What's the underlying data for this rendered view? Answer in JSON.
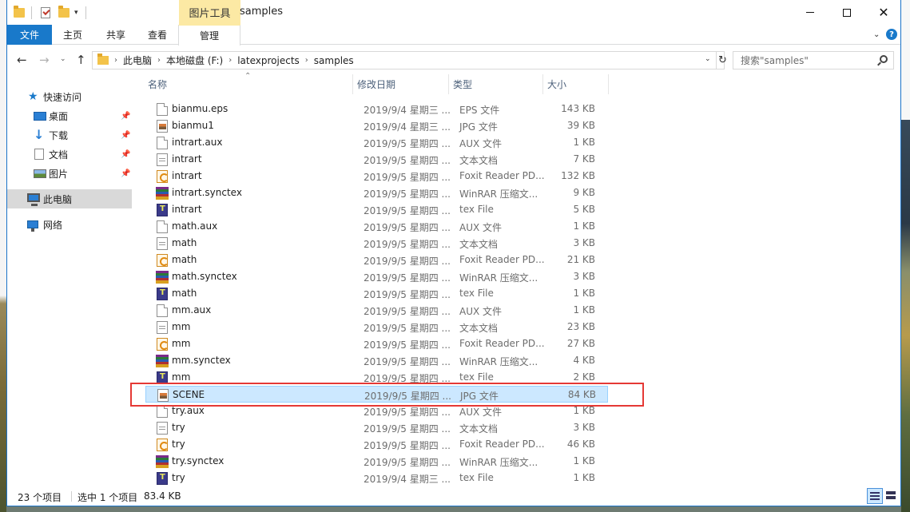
{
  "window": {
    "title": "samples",
    "context_tab_group": "图片工具",
    "quick_access": [
      "folder-icon",
      "properties-check-icon",
      "new-folder-icon",
      "customize-dropdown-icon"
    ]
  },
  "ribbon": {
    "tabs": [
      {
        "label": "文件",
        "active": true
      },
      {
        "label": "主页"
      },
      {
        "label": "共享"
      },
      {
        "label": "查看"
      },
      {
        "label": "管理"
      }
    ]
  },
  "address": {
    "breadcrumbs": [
      "此电脑",
      "本地磁盘 (F:)",
      "latexprojects",
      "samples"
    ]
  },
  "search": {
    "placeholder": "搜索\"samples\""
  },
  "navpane": {
    "quick_access": "快速访问",
    "items": [
      {
        "label": "桌面",
        "icon": "desktop-icon",
        "pinned": true
      },
      {
        "label": "下载",
        "icon": "download-icon",
        "pinned": true
      },
      {
        "label": "文档",
        "icon": "documents-icon",
        "pinned": true
      },
      {
        "label": "图片",
        "icon": "pictures-icon",
        "pinned": true
      }
    ],
    "this_pc": "此电脑",
    "network": "网络"
  },
  "columns": {
    "name": "名称",
    "date": "修改日期",
    "type": "类型",
    "size": "大小"
  },
  "files": [
    {
      "name": "bianmu.eps",
      "date": "2019/9/4 星期三 ...",
      "type": "EPS 文件",
      "size": "143 KB",
      "icon": "blank"
    },
    {
      "name": "bianmu1",
      "date": "2019/9/4 星期三 ...",
      "type": "JPG 文件",
      "size": "39 KB",
      "icon": "jpg"
    },
    {
      "name": "intrart.aux",
      "date": "2019/9/5 星期四 ...",
      "type": "AUX 文件",
      "size": "1 KB",
      "icon": "blank"
    },
    {
      "name": "intrart",
      "date": "2019/9/5 星期四 ...",
      "type": "文本文档",
      "size": "7 KB",
      "icon": "txt"
    },
    {
      "name": "intrart",
      "date": "2019/9/5 星期四 ...",
      "type": "Foxit Reader PD...",
      "size": "132 KB",
      "icon": "pdf"
    },
    {
      "name": "intrart.synctex",
      "date": "2019/9/5 星期四 ...",
      "type": "WinRAR 压缩文...",
      "size": "9 KB",
      "icon": "rar"
    },
    {
      "name": "intrart",
      "date": "2019/9/5 星期四 ...",
      "type": "tex File",
      "size": "5 KB",
      "icon": "tex"
    },
    {
      "name": "math.aux",
      "date": "2019/9/5 星期四 ...",
      "type": "AUX 文件",
      "size": "1 KB",
      "icon": "blank"
    },
    {
      "name": "math",
      "date": "2019/9/5 星期四 ...",
      "type": "文本文档",
      "size": "3 KB",
      "icon": "txt"
    },
    {
      "name": "math",
      "date": "2019/9/5 星期四 ...",
      "type": "Foxit Reader PD...",
      "size": "21 KB",
      "icon": "pdf"
    },
    {
      "name": "math.synctex",
      "date": "2019/9/5 星期四 ...",
      "type": "WinRAR 压缩文...",
      "size": "3 KB",
      "icon": "rar"
    },
    {
      "name": "math",
      "date": "2019/9/5 星期四 ...",
      "type": "tex File",
      "size": "1 KB",
      "icon": "tex"
    },
    {
      "name": "mm.aux",
      "date": "2019/9/5 星期四 ...",
      "type": "AUX 文件",
      "size": "1 KB",
      "icon": "blank"
    },
    {
      "name": "mm",
      "date": "2019/9/5 星期四 ...",
      "type": "文本文档",
      "size": "23 KB",
      "icon": "txt"
    },
    {
      "name": "mm",
      "date": "2019/9/5 星期四 ...",
      "type": "Foxit Reader PD...",
      "size": "27 KB",
      "icon": "pdf"
    },
    {
      "name": "mm.synctex",
      "date": "2019/9/5 星期四 ...",
      "type": "WinRAR 压缩文...",
      "size": "4 KB",
      "icon": "rar"
    },
    {
      "name": "mm",
      "date": "2019/9/5 星期四 ...",
      "type": "tex File",
      "size": "2 KB",
      "icon": "tex"
    },
    {
      "name": "SCENE",
      "date": "2019/9/5 星期四 ...",
      "type": "JPG 文件",
      "size": "84 KB",
      "icon": "jpg",
      "selected": true
    },
    {
      "name": "try.aux",
      "date": "2019/9/5 星期四 ...",
      "type": "AUX 文件",
      "size": "1 KB",
      "icon": "blank"
    },
    {
      "name": "try",
      "date": "2019/9/5 星期四 ...",
      "type": "文本文档",
      "size": "3 KB",
      "icon": "txt"
    },
    {
      "name": "try",
      "date": "2019/9/5 星期四 ...",
      "type": "Foxit Reader PD...",
      "size": "46 KB",
      "icon": "pdf"
    },
    {
      "name": "try.synctex",
      "date": "2019/9/5 星期四 ...",
      "type": "WinRAR 压缩文...",
      "size": "1 KB",
      "icon": "rar"
    },
    {
      "name": "try",
      "date": "2019/9/4 星期三 ...",
      "type": "tex File",
      "size": "1 KB",
      "icon": "tex"
    }
  ],
  "status": {
    "count": "23 个项目",
    "selection": "选中 1 个项目",
    "selection_size": "83.4 KB"
  },
  "colors": {
    "accent": "#1979ca",
    "context_tab": "#fce9a4",
    "selection": "#cce8ff",
    "highlight_box": "#e53935"
  }
}
